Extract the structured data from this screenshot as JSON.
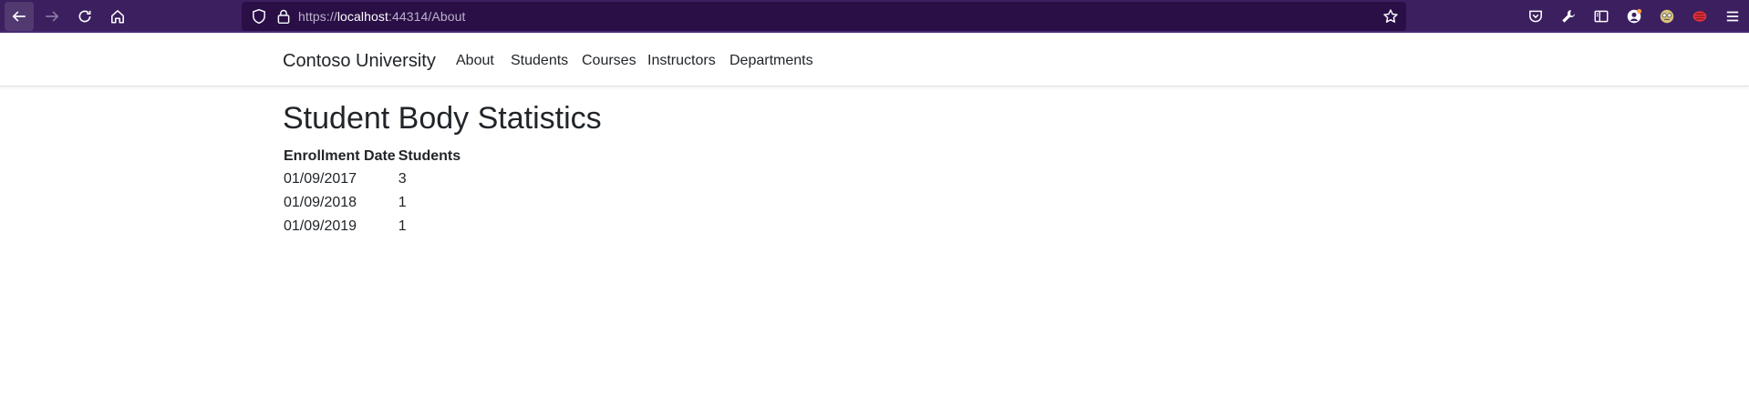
{
  "browser": {
    "url_prefix": "https://",
    "url_host": "localhost",
    "url_path": ":44314/About",
    "accent": "#3b1f5e"
  },
  "header": {
    "brand": "Contoso University",
    "nav": [
      {
        "label": "About"
      },
      {
        "label": "Students"
      },
      {
        "label": "Courses"
      },
      {
        "label": "Instructors"
      },
      {
        "label": "Departments"
      }
    ]
  },
  "main": {
    "title": "Student Body Statistics",
    "table": {
      "headers": [
        "Enrollment Date",
        "Students"
      ],
      "rows": [
        [
          "01/09/2017",
          "3"
        ],
        [
          "01/09/2018",
          "1"
        ],
        [
          "01/09/2019",
          "1"
        ]
      ]
    }
  }
}
